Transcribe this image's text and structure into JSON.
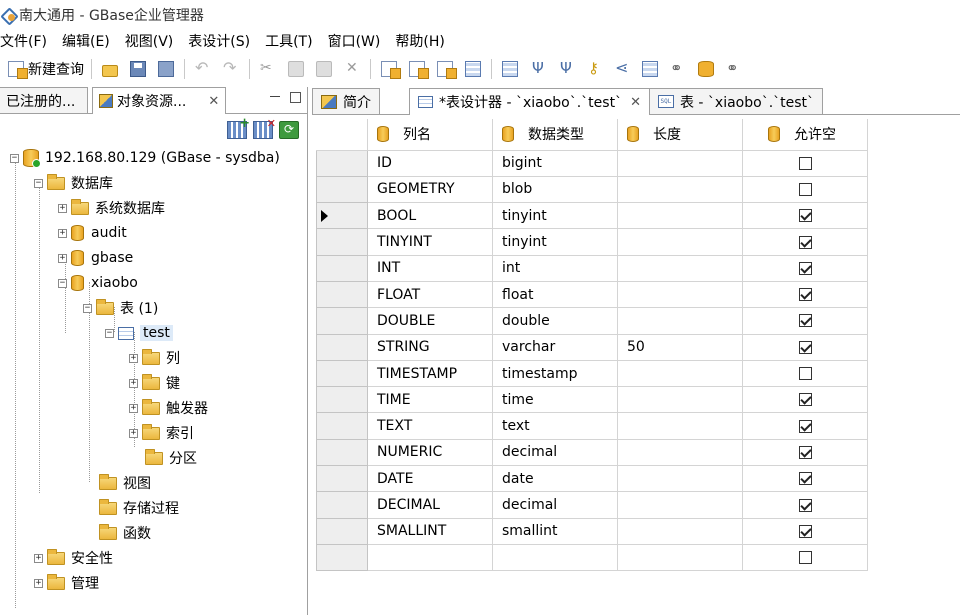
{
  "window": {
    "title": "南大通用 - GBase企业管理器"
  },
  "menu": [
    "文件(F)",
    "编辑(E)",
    "视图(V)",
    "表设计(S)",
    "工具(T)",
    "窗口(W)",
    "帮助(H)"
  ],
  "toolbar": {
    "new_query_label": "新建查询"
  },
  "left_panel": {
    "tabs": [
      {
        "label": "已注册的..."
      },
      {
        "label": "对象资源..."
      }
    ],
    "tree": {
      "server": "192.168.80.129 (GBase - sysdba)",
      "databases_folder": "数据库",
      "system_db_folder": "系统数据库",
      "db_audit": "audit",
      "db_gbase": "gbase",
      "db_xiaobo": "xiaobo",
      "tables_folder": "表 (1)",
      "table_test": "test",
      "col_folder": "列",
      "key_folder": "键",
      "trigger_folder": "触发器",
      "index_folder": "索引",
      "partition_folder": "分区",
      "view_folder": "视图",
      "proc_folder": "存储过程",
      "func_folder": "函数",
      "security_folder": "安全性",
      "manage_folder": "管理"
    }
  },
  "right_panel": {
    "tabs": [
      {
        "label": "简介"
      },
      {
        "label": "*表设计器 - `xiaobo`.`test`"
      },
      {
        "label": "表 - `xiaobo`.`test`"
      }
    ],
    "designer": {
      "columns": [
        "列名",
        "数据类型",
        "长度",
        "允许空"
      ],
      "rows": [
        {
          "name": "ID",
          "type": "bigint",
          "length": "",
          "nullable": false
        },
        {
          "name": "GEOMETRY",
          "type": "blob",
          "length": "",
          "nullable": false
        },
        {
          "name": "BOOL",
          "type": "tinyint",
          "length": "",
          "nullable": true
        },
        {
          "name": "TINYINT",
          "type": "tinyint",
          "length": "",
          "nullable": true
        },
        {
          "name": "INT",
          "type": "int",
          "length": "",
          "nullable": true
        },
        {
          "name": "FLOAT",
          "type": "float",
          "length": "",
          "nullable": true
        },
        {
          "name": "DOUBLE",
          "type": "double",
          "length": "",
          "nullable": true
        },
        {
          "name": "STRING",
          "type": "varchar",
          "length": "50",
          "nullable": true
        },
        {
          "name": "TIMESTAMP",
          "type": "timestamp",
          "length": "",
          "nullable": false
        },
        {
          "name": "TIME",
          "type": "time",
          "length": "",
          "nullable": true
        },
        {
          "name": "TEXT",
          "type": "text",
          "length": "",
          "nullable": true
        },
        {
          "name": "NUMERIC",
          "type": "decimal",
          "length": "",
          "nullable": true
        },
        {
          "name": "DATE",
          "type": "date",
          "length": "",
          "nullable": true
        },
        {
          "name": "DECIMAL",
          "type": "decimal",
          "length": "",
          "nullable": true
        },
        {
          "name": "SMALLINT",
          "type": "smallint",
          "length": "",
          "nullable": true
        },
        {
          "name": "",
          "type": "",
          "length": "",
          "nullable": false
        }
      ],
      "current_row": 2
    }
  }
}
